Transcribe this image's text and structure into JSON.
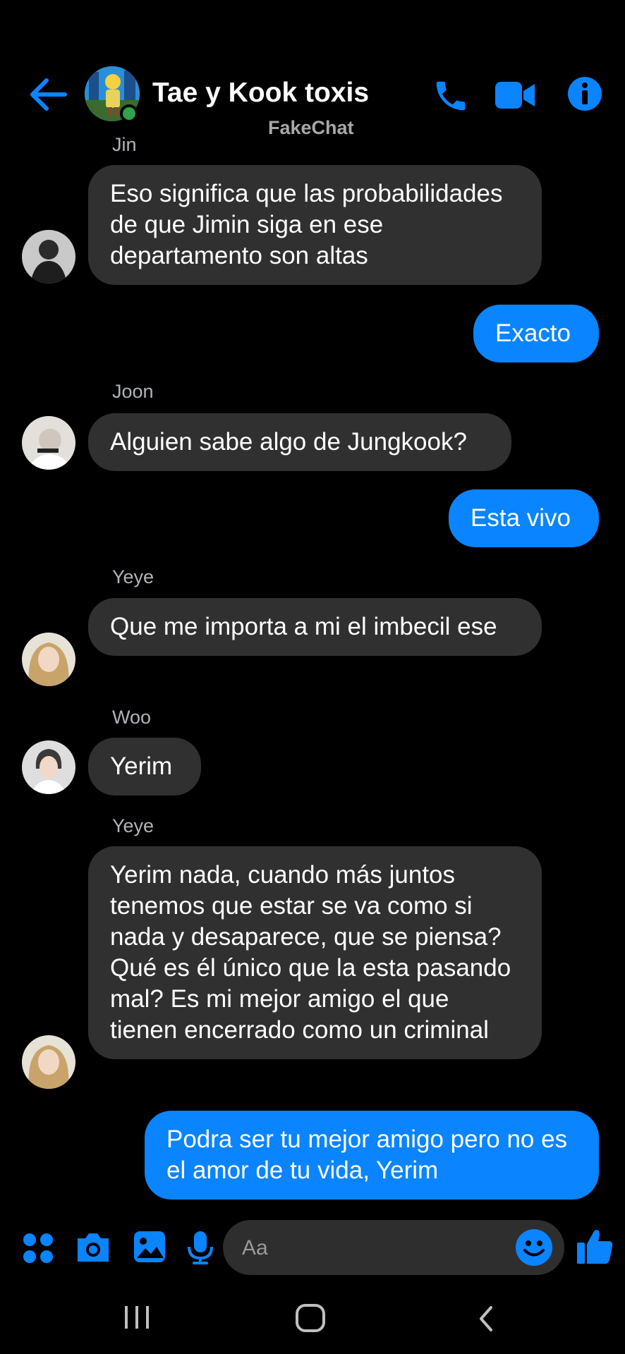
{
  "header": {
    "title": "Tae y Kook toxis",
    "subtitle": "FakeChat",
    "icons": [
      "back-arrow-icon",
      "phone-icon",
      "video-camera-icon",
      "info-icon"
    ],
    "accent": "#0a84ff"
  },
  "messages": [
    {
      "sender": "Jin",
      "text": "Eso significa que las probabilidades de que Jimin siga en ese departamento son altas"
    },
    {
      "sender": "me",
      "text": "Exacto"
    },
    {
      "sender": "Joon",
      "text": "Alguien sabe algo de Jungkook?"
    },
    {
      "sender": "me",
      "text": "Esta vivo"
    },
    {
      "sender": "Yeye",
      "text": "Que me importa a mi el imbecil ese"
    },
    {
      "sender": "Woo",
      "text": "Yerim"
    },
    {
      "sender": "Yeye",
      "text": "Yerim nada, cuando más juntos tenemos que estar se va como si nada y desaparece, que se piensa? Qué es él único que la esta pasando mal? Es mi mejor amigo el que tienen encerrado como un criminal"
    },
    {
      "sender": "me",
      "text": "Podra ser tu mejor amigo pero no es el amor de tu vida, Yerim"
    }
  ],
  "composer": {
    "placeholder": "Aa",
    "icons": [
      "apps-grid-icon",
      "camera-icon",
      "gallery-icon",
      "microphone-icon",
      "emoji-icon",
      "thumbs-up-icon"
    ]
  },
  "colors": {
    "incoming_bubble": "#303030",
    "outgoing_bubble": "#0a84ff",
    "online": "#31a24c"
  }
}
